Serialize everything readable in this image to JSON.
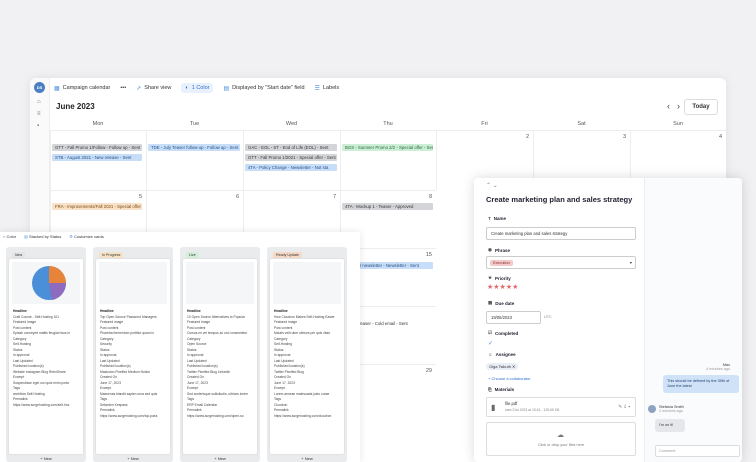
{
  "calendar": {
    "toolbar": {
      "campaign": "Campaign calendar",
      "more": "•••",
      "share": "Share view",
      "color": "1 Color",
      "displayed": "Displayed by \"Start date\" field",
      "labels": "Labels"
    },
    "avatar_initials": "DS",
    "month": "June 2023",
    "today": "Today",
    "weekdays": [
      "Mon",
      "Tue",
      "Wed",
      "Thu",
      "Fri",
      "Sat",
      "Sun"
    ],
    "day_numbers": {
      "fri1": "2",
      "sat1": "3",
      "sun1": "4",
      "mon2": "5",
      "tue2": "6",
      "wed2": "7",
      "thu2": "8",
      "thu3": "15",
      "thu5": "29"
    },
    "events": {
      "e1": "GTT - Fall Promo 1/Follow - Follow up - Sent",
      "e2": "STB - August 2021 - New release - Sent",
      "e3": "TDE - July Teaser follow-up - Follow up - Sent",
      "e4": "GAC - EOL - ST - End of Life (EOL) - Sent",
      "e5": "GTT - Fall Promo 1/2021 - Special offer - Sent",
      "e6": "4TA - Policy Change - Newsletter - Not sta",
      "e7": "BGS - Summer Promo 2/2 - Special offer - Sent",
      "e8": "FRA - Improvements/Fall 2021 - Special offer",
      "e9": "4TA - Mockup 1 - Teaser - Approved",
      "e10": "Summer newsletter - Newsletter - Sent",
      "e11": "Sanity Teaser - Cold email - Sent"
    }
  },
  "kanban": {
    "toolbar": [
      "Color",
      "Stacked by Status",
      "Customize cards"
    ],
    "columns": [
      {
        "tag": "Idea",
        "tag_color": "#e4e4e4",
        "headline": "Craft Course - Self-Hosting 101",
        "lines": [
          "Featured image",
          "Post content",
          "Splash conveyed mattis feugiat risus in",
          "Category",
          "Self-Hosting",
          "Status",
          "In approval",
          "Last Updated",
          "Published location(s)",
          "Website Instagram Blog RetroShare",
          "Excerpt",
          "Suspendisse eget orci quis enim porta",
          "Tags",
          "workflow Self-Hosting",
          "Permalink",
          "https://www.surgehosting.com/self-hos"
        ]
      },
      {
        "tag": "In Progress",
        "tag_color": "#f6e2c6",
        "headline": "Top Open Source Password Managers",
        "lines": [
          "Featured image",
          "Post content",
          "Pharetra fermentum porttitor quam in",
          "Category",
          "Security",
          "Status",
          "In approval",
          "Last Updated",
          "Published location(s)",
          "Mastodon Pixelfed Medium Notion",
          "Created On",
          "June 17, 2023",
          "Excerpt",
          "Maecenas blandit sapien urna sed quis",
          "Tags",
          "Selwrden Keepass",
          "Permalink",
          "https://www.surgehosting.com/top-pass"
        ]
      },
      {
        "tag": "Live",
        "tag_color": "#d3efd9",
        "headline": "10 Open Source Alternatives to Popular",
        "lines": [
          "Featured image",
          "Post content",
          "Cursus mi vel tempus ac orci consectetur",
          "Category",
          "Open Source",
          "Status",
          "In approval",
          "Last Updated",
          "Published location(s)",
          "Twitter Pixelfed Blog LinkedIn",
          "Created On",
          "June 17, 2023",
          "Excerpt",
          "Sed scelerisque sollicitudin, ultrices lorem",
          "Tags",
          "ERP Email Calendar",
          "Permalink",
          "https://www.surgehosting.com/open-so"
        ]
      },
      {
        "tag": "Ready Update",
        "tag_color": "#f7d9c8",
        "headline": "How Cloudron Makes Self-Hosting Easier",
        "lines": [
          "Featured image",
          "Post content",
          "Mauris velit uber ultrices per quis vitae",
          "Category",
          "Self-Hosting",
          "Status",
          "In approval",
          "Last Updated",
          "Published location(s)",
          "Twitter Pixelfed Blog",
          "Created On",
          "June 17, 2023",
          "Excerpt",
          "Lorem aenean malesuada justo curae",
          "Tags",
          "Cloudron",
          "Permalink",
          "https://www.surgehosting.com/cloudron"
        ]
      }
    ],
    "add_new": "+ New"
  },
  "panel": {
    "title": "Create marketing plan and sales strategy",
    "name_label": "Name",
    "name_value": "Create marketing plan and sales strategy",
    "phase_label": "Phrase",
    "phase_value": "Execution",
    "priority_label": "Priority",
    "due_label": "Due date",
    "due_value": "19/06/2023",
    "tz": "UTC",
    "completed_label": "Completed",
    "assignee_label": "Assignee",
    "assignee_value": "Olga Tsikuth",
    "choose": "+ Choose a collaborator",
    "materials_label": "Materials",
    "file_name": "file.pdf",
    "file_meta": "sam 21st 2023 at 15:16 - 125.65 KB",
    "drop": "Click or drop your files here",
    "chat_name1": "Max",
    "chat_time1": "4 minutes ago",
    "chat_msg1": "This should be defined by the 30th of June the latest",
    "chat_name2": "Stefania Smith",
    "chat_time2": "2 minutes ago",
    "chat_msg2": "I'm on it!",
    "comment_placeholder": "Comment"
  },
  "colors": {
    "accent": "#4a90e2",
    "star": "#e46a6a"
  }
}
